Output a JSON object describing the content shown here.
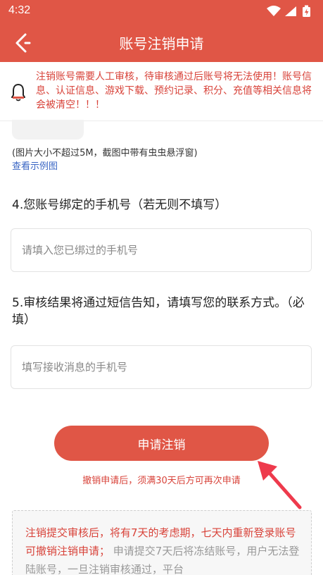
{
  "status_bar": {
    "time": "4:32"
  },
  "app_bar": {
    "title": "账号注销申请"
  },
  "notice": {
    "text": "注销账号需要人工审核，待审核通过后账号将无法使用！账号信息、认证信息、游戏下载、预约记录、积分、充值等相关信息将会被清空！！！"
  },
  "upload": {
    "hint": "(图片大小不超过5M，截图中带有虫虫悬浮窗)",
    "example_link": "查看示例图"
  },
  "question4": {
    "label": "4.您账号绑定的手机号（若无则不填写）",
    "placeholder": "请填入您已绑过的手机号"
  },
  "question5": {
    "label": "5.审核结果将通过短信告知，请填写您的联系方式。（必填）",
    "placeholder": "填写接收消息的手机号"
  },
  "submit": {
    "label": "申请注销",
    "note": "撤销申请后，须满30天后方可再次申请"
  },
  "info": {
    "highlight": "注销提交审核后，将有7天的考虑期，七天内重新登录账号可撤销注销申请；",
    "rest": "申请提交7天后将冻结账号，用户无法登陆账号，一旦注销审核通过，平台"
  },
  "colors": {
    "accent": "#e05646",
    "warning_text": "#d8433a",
    "link": "#3a66c4"
  }
}
